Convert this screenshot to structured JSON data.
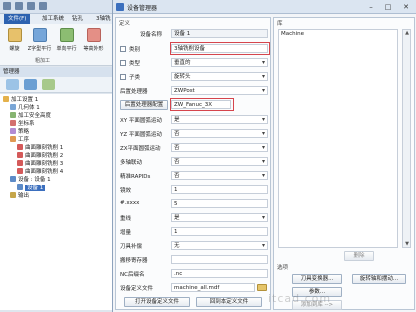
{
  "app": {
    "ribbon_tabs": [
      "文件(F)",
      "加工系统",
      "钻孔",
      "3轴铣"
    ],
    "ribbon_buttons": [
      "螺旋",
      "Z字型平行",
      "单向平行",
      "等高外形"
    ],
    "group_label": "粗加工"
  },
  "manager": {
    "title": "管理器",
    "tree": [
      {
        "label": "加工设置 1",
        "icon": "folder-icon"
      },
      {
        "label": "几何体 1",
        "icon": "geometry-icon"
      },
      {
        "label": "加工安全高度",
        "icon": "height-icon"
      },
      {
        "label": "坐标系",
        "icon": "axis-icon"
      },
      {
        "label": "策略",
        "icon": "strategy-icon"
      },
      {
        "label": "工序",
        "icon": "operation-icon"
      },
      {
        "label": "曲面雕刻铣削 1",
        "icon": "toolpath-icon"
      },
      {
        "label": "曲面雕刻铣削 2",
        "icon": "toolpath-icon"
      },
      {
        "label": "曲面雕刻铣削 3",
        "icon": "toolpath-icon"
      },
      {
        "label": "曲面雕刻铣削 4",
        "icon": "toolpath-icon"
      },
      {
        "label": "设备 : 设备 1",
        "icon": "machine-icon"
      },
      {
        "label": "设备 1",
        "icon": "machine-icon"
      },
      {
        "label": "输出",
        "icon": "output-icon"
      }
    ]
  },
  "dialog": {
    "title": "设备管理器",
    "definition": {
      "title": "定义",
      "col_name": "设备名称",
      "col_value": "设备 1",
      "rows": [
        {
          "label": "类别",
          "value": "3轴铣削设备",
          "check": true
        },
        {
          "label": "类型",
          "value": "垂直的",
          "check": true
        },
        {
          "label": "子类",
          "value": "旋转头",
          "check": true
        },
        {
          "label": "后置处理器",
          "value": "ZWPost"
        },
        {
          "label": "后置处理器配置",
          "value": "ZW_Fanuc_3X"
        },
        {
          "label": "XY 平面圆弧运动",
          "value": "是"
        },
        {
          "label": "YZ 平面圆弧运动",
          "value": "否"
        },
        {
          "label": "ZX平面圆弧运动",
          "value": "否"
        },
        {
          "label": "多轴联动",
          "value": "否"
        },
        {
          "label": "精准RAPIDs",
          "value": "否"
        },
        {
          "label": "镜效",
          "value": "1"
        },
        {
          "label": "#.xxxx",
          "value": "5"
        },
        {
          "label": "重线",
          "value": "是"
        },
        {
          "label": "增量",
          "value": "1"
        },
        {
          "label": "刀具补偿",
          "value": "无"
        },
        {
          "label": "搬移寄存器",
          "value": ""
        },
        {
          "label": "NC后缀名",
          "value": ".nc"
        },
        {
          "label": "设备定义文件",
          "value": "machine_all.mdf"
        }
      ],
      "btn_open": "打开设备定义文件",
      "btn_return": "回到本定义文件"
    },
    "library": {
      "title": "库",
      "items": [
        "Machine"
      ],
      "btn_delete": "删除"
    },
    "options": {
      "title": "选项",
      "btn_tool": "刀具变换器...",
      "btn_rotary": "旋转轴和摆动...",
      "btn_params": "参数...",
      "btn_add": "添加到库 -->"
    }
  },
  "watermark": "itcad.com"
}
